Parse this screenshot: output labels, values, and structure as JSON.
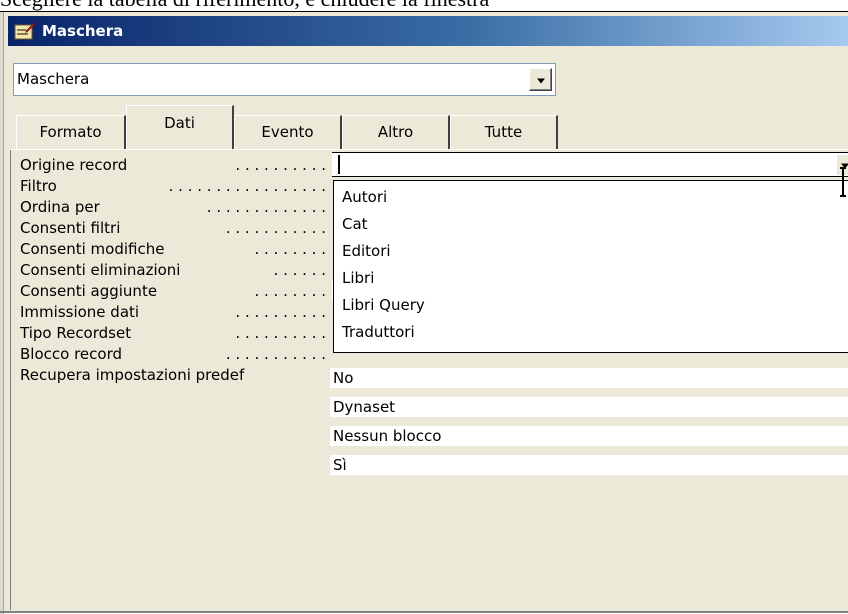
{
  "caption": "Scegliere la tabella di riferimento, e chiudere la finestra",
  "window": {
    "title": "Maschera",
    "icon": "properties-icon"
  },
  "selector": {
    "value": "Maschera"
  },
  "tabs": [
    {
      "label": "Formato",
      "active": false
    },
    {
      "label": "Dati",
      "active": true
    },
    {
      "label": "Evento",
      "active": false
    },
    {
      "label": "Altro",
      "active": false
    },
    {
      "label": "Tutte",
      "active": false
    }
  ],
  "properties": [
    {
      "label": "Origine record",
      "value": ""
    },
    {
      "label": "Filtro",
      "value": ""
    },
    {
      "label": "Ordina per",
      "value": ""
    },
    {
      "label": "Consenti filtri",
      "value": ""
    },
    {
      "label": "Consenti modifiche",
      "value": ""
    },
    {
      "label": "Consenti eliminazioni",
      "value": ""
    },
    {
      "label": "Consenti aggiunte",
      "value": "Sì"
    },
    {
      "label": "Immissione dati",
      "value": "No"
    },
    {
      "label": "Tipo Recordset",
      "value": "Dynaset"
    },
    {
      "label": "Blocco record",
      "value": "Nessun blocco"
    },
    {
      "label": "Recupera impostazioni predef",
      "value": "Sì"
    }
  ],
  "dropdown_options": [
    "Autori",
    "Cat",
    "Editori",
    "Libri",
    "Libri Query",
    "Traduttori"
  ],
  "colors": {
    "title_start": "#0a246a",
    "title_end": "#a6caf0",
    "face": "#ece9d8"
  }
}
